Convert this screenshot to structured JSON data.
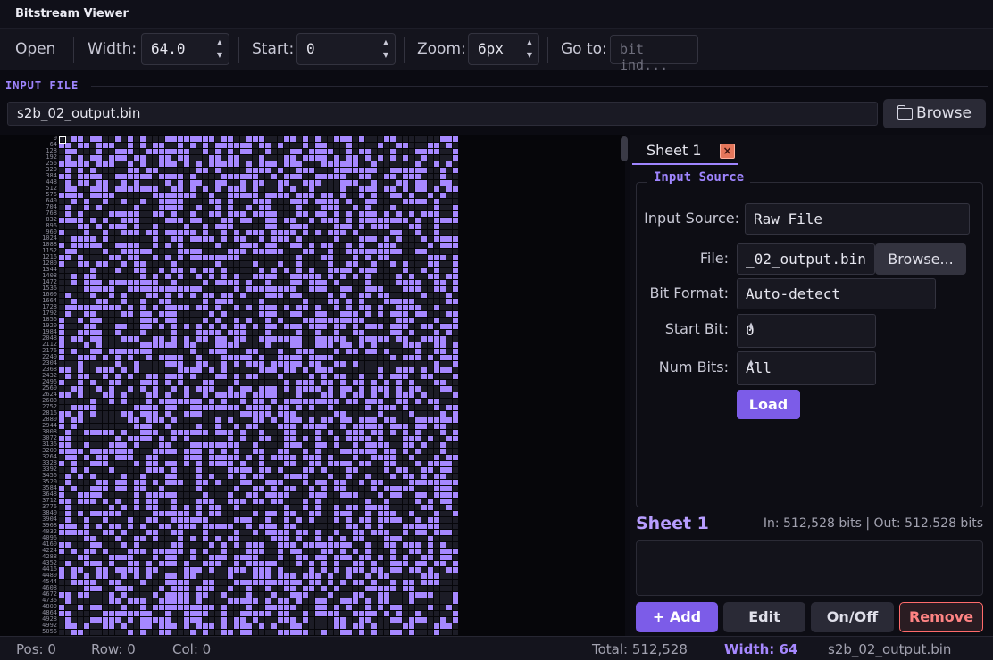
{
  "app": {
    "title": "Bitstream Viewer"
  },
  "toolbar": {
    "open_label": "Open",
    "width_label": "Width:",
    "width_value": "64.0",
    "start_label": "Start:",
    "start_value": "0",
    "zoom_label": "Zoom:",
    "zoom_value": "6px",
    "goto_label": "Go to:",
    "goto_placeholder": "bit ind..."
  },
  "input_file": {
    "section_label": "INPUT FILE",
    "path": "s2b_02_output.bin",
    "browse_label": "Browse"
  },
  "bit_view": {
    "row_labels": [
      "0",
      "64",
      "128",
      "192",
      "256",
      "320",
      "384",
      "448",
      "512",
      "576",
      "640",
      "704",
      "768",
      "832",
      "896",
      "960",
      "1024",
      "1088",
      "1152",
      "1216",
      "1280",
      "1344",
      "1408",
      "1472",
      "1536",
      "1600",
      "1664",
      "1728",
      "1792",
      "1856",
      "1920",
      "1984",
      "2048",
      "2112",
      "2176",
      "2240",
      "2304",
      "2368",
      "2432",
      "2496",
      "2560",
      "2624",
      "2688",
      "2752",
      "2816",
      "2880",
      "2944",
      "3008",
      "3072",
      "3136",
      "3200",
      "3264",
      "3328",
      "3392",
      "3456",
      "3520",
      "3584",
      "3648",
      "3712",
      "3776",
      "3840",
      "3904",
      "3968",
      "4032",
      "4096",
      "4160",
      "4224",
      "4288",
      "4352",
      "4416",
      "4480",
      "4544",
      "4608",
      "4672",
      "4736",
      "4800",
      "4864",
      "4928",
      "4992",
      "5056"
    ],
    "bits_per_row": 64,
    "colors": {
      "on": "#a688ff",
      "off": "#1c1c26"
    }
  },
  "sheet_panel": {
    "tab_label": "Sheet 1",
    "tab_close_icon": "×",
    "group_title": "Input Source",
    "input_source_label": "Input Source:",
    "input_source_value": "Raw File",
    "file_label": "File:",
    "file_value": "_02_output.bin",
    "file_browse_label": "Browse...",
    "bit_format_label": "Bit Format:",
    "bit_format_value": "Auto-detect",
    "start_bit_label": "Start Bit:",
    "start_bit_value": "0",
    "num_bits_label": "Num Bits:",
    "num_bits_value": "All",
    "load_label": "Load",
    "sheet_name": "Sheet 1",
    "stats": "In: 512,528 bits | Out: 512,528 bits",
    "actions": {
      "add": "+ Add",
      "edit": "Edit",
      "onoff": "On/Off",
      "remove": "Remove"
    }
  },
  "status": {
    "pos": "Pos: 0",
    "row": "Row: 0",
    "col": "Col: 0",
    "total": "Total: 512,528",
    "width": "Width: 64",
    "file": "s2b_02_output.bin"
  },
  "accent_color": "#9f85ff",
  "danger_color": "#ff6b6b"
}
